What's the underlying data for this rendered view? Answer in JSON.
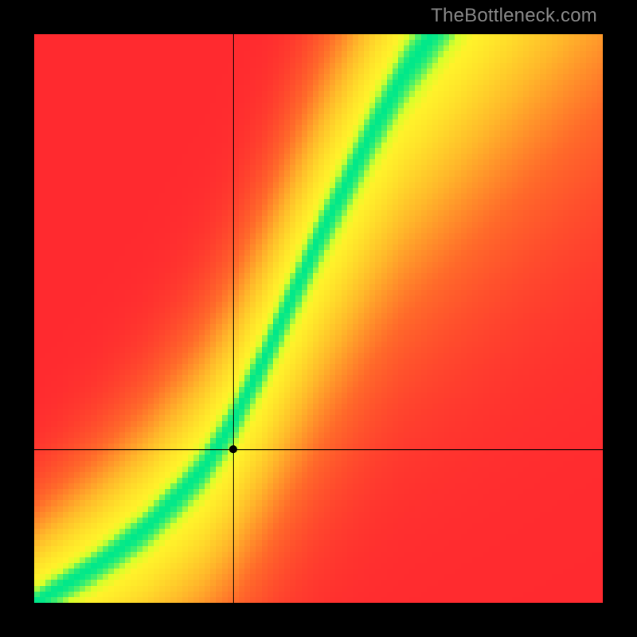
{
  "watermark": "TheBottleneck.com",
  "chart_data": {
    "type": "heatmap",
    "title": "",
    "xlabel": "",
    "ylabel": "",
    "xlim": [
      0,
      1
    ],
    "ylim": [
      0,
      1
    ],
    "crosshair": {
      "x": 0.35,
      "y": 0.27
    },
    "marker": {
      "x": 0.35,
      "y": 0.27
    },
    "ideal_curve": {
      "description": "green optimal band; curve y = f(x) in normalized 0..1 axes",
      "points": [
        [
          0.0,
          0.0
        ],
        [
          0.05,
          0.03
        ],
        [
          0.1,
          0.06
        ],
        [
          0.15,
          0.095
        ],
        [
          0.2,
          0.135
        ],
        [
          0.25,
          0.185
        ],
        [
          0.3,
          0.24
        ],
        [
          0.35,
          0.32
        ],
        [
          0.4,
          0.42
        ],
        [
          0.45,
          0.53
        ],
        [
          0.5,
          0.64
        ],
        [
          0.55,
          0.74
        ],
        [
          0.6,
          0.84
        ],
        [
          0.65,
          0.93
        ],
        [
          0.7,
          1.0
        ]
      ],
      "band_halfwidth_top": 0.028,
      "band_halfwidth_bottom": 0.008
    },
    "colorscale": {
      "stops": [
        [
          0.0,
          "#ff2a2f"
        ],
        [
          0.3,
          "#ff6a2a"
        ],
        [
          0.55,
          "#ffb72a"
        ],
        [
          0.78,
          "#fff22a"
        ],
        [
          0.9,
          "#d8ff2a"
        ],
        [
          1.0,
          "#00e88a"
        ]
      ]
    },
    "resolution": 100
  }
}
